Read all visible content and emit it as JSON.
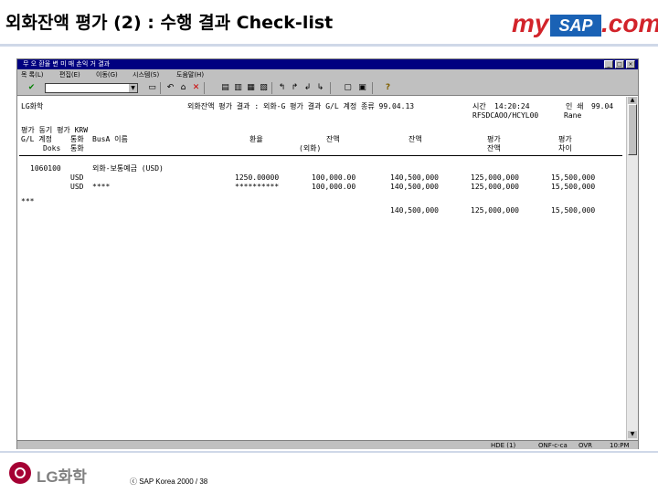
{
  "slide": {
    "title": "외화잔액 평가 (2) : 수행 결과 Check-list",
    "logo": {
      "my": "my",
      "sap": "SAP",
      "com": ".com"
    },
    "footer": {
      "company": "LG화학",
      "copyright": "ⓒ  SAP Korea 2000  /  38"
    }
  },
  "window": {
    "title": "무  오 환율 변  미  매  손익  거  결과",
    "controls": [
      "_",
      "□",
      "×"
    ],
    "menus": [
      "목 록(L)",
      "편집(E)",
      "이동(G)",
      "시스템(S)",
      "도움말(H)"
    ],
    "toolbar_icons": [
      "check-icon",
      "save-icon",
      "back-icon",
      "exit-icon",
      "cancel-icon",
      "print-icon",
      "find-icon",
      "find-next-icon",
      "first-page-icon",
      "prev-page-icon",
      "next-page-icon",
      "last-page-icon",
      "new-session-icon",
      "shortcut-icon",
      "help-icon"
    ],
    "status": {
      "segment1": "HDE  (1)",
      "segment2": "ONF-c-ca",
      "segment3": "OVR",
      "segment4": "10:PM"
    }
  },
  "report": {
    "header": {
      "company": "LG화학",
      "report_title": "외화잔액 평가 결과 : 외화-G 평가 결과 G/L 계정 종류 99.04.13",
      "time_label": "시간",
      "time_value": "14:20:24",
      "page_label": "인 쇄",
      "page_value": "99.04",
      "program": "RFSDCAOO/HCYL00",
      "user": "Rane"
    },
    "columns": {
      "row1": [
        "평가 동기 평가 KRW"
      ],
      "row2": [
        "G/L 계정",
        "통화",
        "BusA 이름",
        "환율",
        "잔액",
        "잔액",
        "평가",
        "평가"
      ],
      "row3": [
        "Doks",
        "통화",
        "(외화)",
        "",
        "잔액",
        "차이"
      ]
    },
    "rows": [
      {
        "account": "1060100",
        "description": "외화-보통예금 (USD)",
        "lines": [
          {
            "currency": "USD",
            "rate": "1250.00000",
            "foreign": "100,000.00",
            "balance": "140,500,000",
            "valuation": "125,000,000",
            "diff": "15,500,000"
          },
          {
            "currency": "USD",
            "busa": "****",
            "rate": "**********",
            "foreign": "100,000.00",
            "balance": "140,500,000",
            "valuation": "125,000,000",
            "diff": "15,500,000"
          }
        ]
      }
    ],
    "total_marker": "***",
    "totals": {
      "balance": "140,500,000",
      "valuation": "125,000,000",
      "diff": "15,500,000"
    }
  },
  "colors": {
    "titlebar": "#000080",
    "chrome": "#c0c0c0",
    "logo_red": "#d2232a",
    "logo_blue": "#1a62b5",
    "lg_red": "#a50034"
  }
}
